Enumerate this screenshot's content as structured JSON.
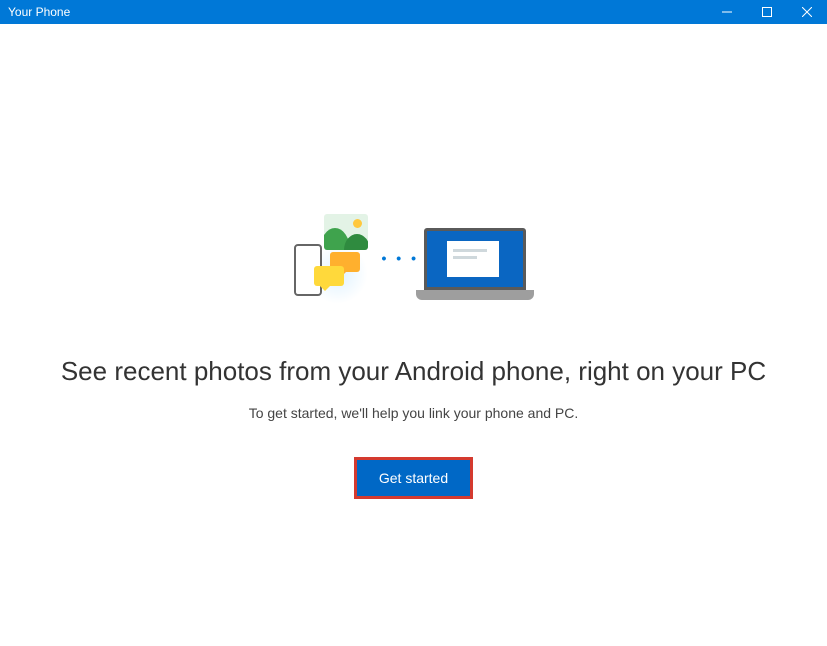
{
  "window": {
    "title": "Your Phone"
  },
  "titlebar": {
    "minimize_icon": "minimize",
    "maximize_icon": "maximize",
    "close_icon": "close"
  },
  "illustration": {
    "connection_dots": "• • • • •"
  },
  "main": {
    "headline": "See recent photos from your Android phone, right on your PC",
    "subtext": "To get started, we'll help you link your phone and PC.",
    "cta_label": "Get started"
  },
  "colors": {
    "accent": "#0078d7",
    "highlight_border": "#d43a2f"
  }
}
